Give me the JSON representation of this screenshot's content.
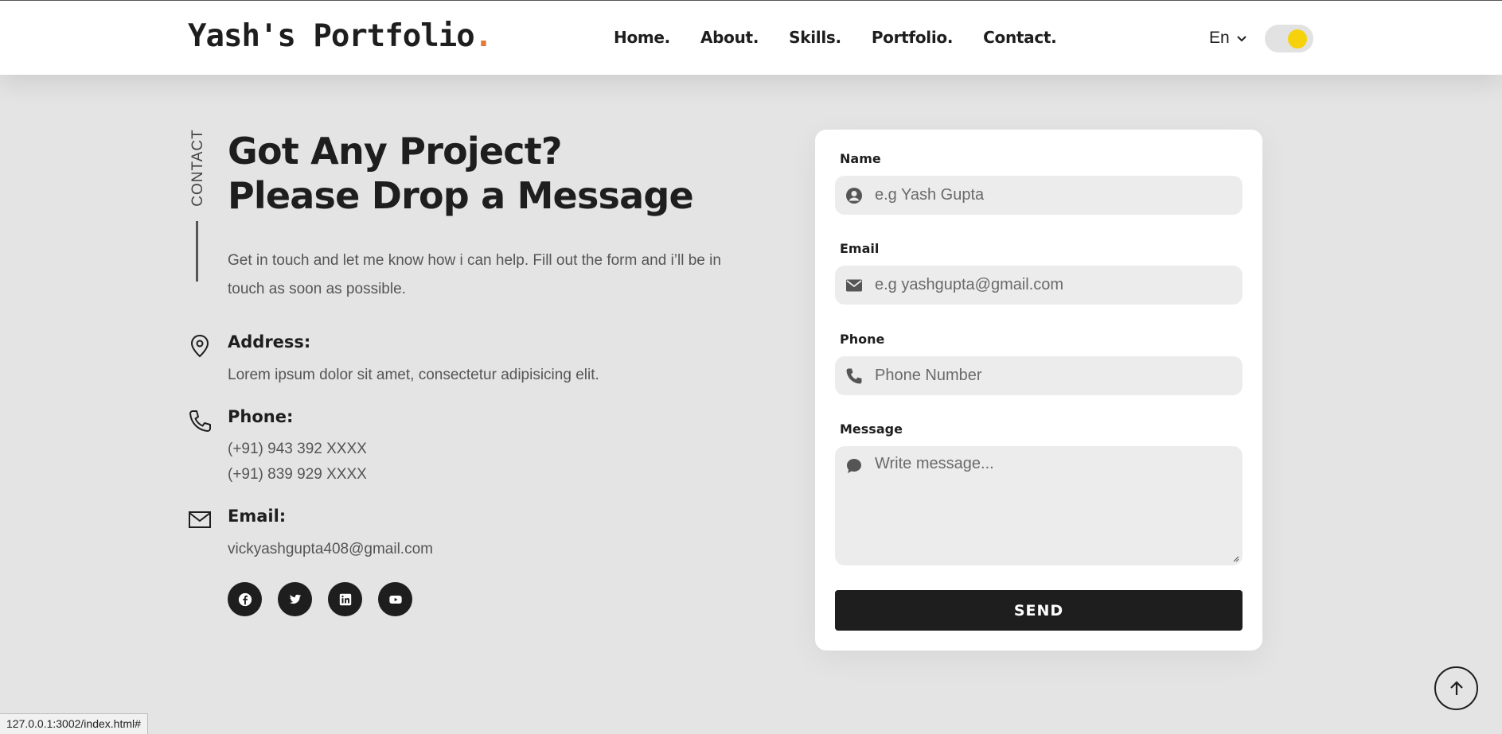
{
  "header": {
    "logo_text": "Yash's Portfolio",
    "logo_dot": ".",
    "nav": [
      "Home.",
      "About.",
      "Skills.",
      "Portfolio.",
      "Contact."
    ],
    "language": "En",
    "theme_toggle_color": "#f5d20c"
  },
  "contact": {
    "section_label": "CONTACT",
    "heading_line1": "Got Any Project?",
    "heading_line2": "Please Drop a Message",
    "intro": "Get in touch and let me know how i can help. Fill out the form and i’ll be in touch as soon as possible.",
    "address_title": "Address:",
    "address_text": "Lorem ipsum dolor sit amet, consectetur adipisicing elit.",
    "phone_title": "Phone:",
    "phone_1": "(+91) 943 392 XXXX",
    "phone_2": "(+91) 839 929 XXXX",
    "email_title": "Email:",
    "email_text": "vickyashgupta408@gmail.com",
    "socials": [
      "facebook-icon",
      "twitter-icon",
      "linkedin-icon",
      "youtube-icon"
    ]
  },
  "form": {
    "name_label": "Name",
    "name_placeholder": "e.g Yash Gupta",
    "email_label": "Email",
    "email_placeholder": "e.g yashgupta@gmail.com",
    "phone_label": "Phone",
    "phone_placeholder": "Phone Number",
    "message_label": "Message",
    "message_placeholder": "Write message...",
    "send_label": "SEND"
  },
  "status_bar": {
    "url": "127.0.0.1:3002/index.html#"
  },
  "colors": {
    "accent": "#e07b39",
    "background": "#e4e4e4",
    "dark": "#1e1e1e"
  }
}
